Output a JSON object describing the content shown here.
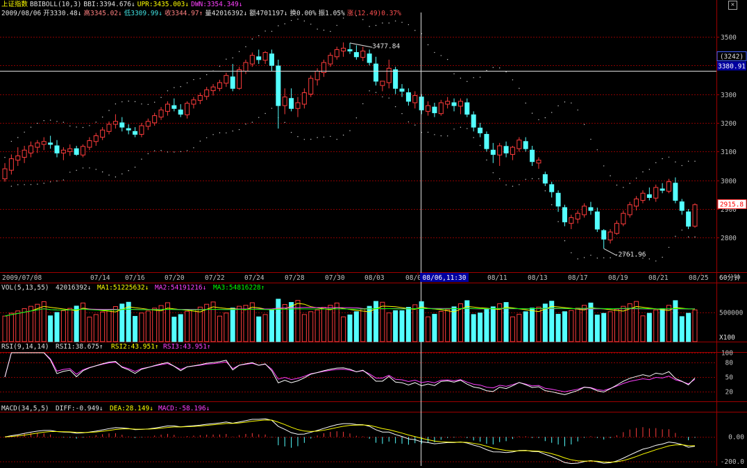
{
  "header": {
    "index_name": "上证指数",
    "indicator": "BBIBOLL(10,3)",
    "bbi": "BBI:3394.676↓",
    "upr": "UPR:3435.003↓",
    "dwn": "DWN:3354.349↓",
    "date": "2009/08/06",
    "open": "开3330.48↓",
    "high": "高3345.02↓",
    "low": "低3309.99↓",
    "close": "收3344.97↑",
    "volume": "量42016392↓",
    "amount": "额4701197↓",
    "turnover": "换0.00%",
    "amplitude": "振1.05%",
    "change": "涨(12.49)0.37%"
  },
  "colors": {
    "up": "#ff3c3c",
    "down": "#54ffff",
    "background": "#000000",
    "grid": "#8b0000",
    "ma1": "#ffff00",
    "ma2": "#ff40ff",
    "ma3": "#00ff00",
    "rsi1": "#ffffff",
    "rsi2": "#ffff00",
    "rsi3": "#ff40ff"
  },
  "icons": {
    "close": "close-icon"
  },
  "chart_data": [
    {
      "type": "candlestick",
      "panel": "price",
      "yticks": [
        2800,
        2900,
        3000,
        3100,
        3200,
        3300,
        3400,
        3500
      ],
      "ylim": [
        2680,
        3560
      ],
      "crosshair_value": "3380.91",
      "crosshair_count": "(3242)",
      "last_price_tag": "2915.8",
      "annotation_high": "3477.84",
      "annotation_low": "2761.96",
      "candles": [
        [
          3005,
          3060,
          2995,
          3040
        ],
        [
          3035,
          3090,
          3020,
          3075
        ],
        [
          3070,
          3115,
          3050,
          3085
        ],
        [
          3080,
          3120,
          3060,
          3105
        ],
        [
          3095,
          3135,
          3080,
          3120
        ],
        [
          3115,
          3140,
          3095,
          3130
        ],
        [
          3125,
          3150,
          3105,
          3135
        ],
        [
          3130,
          3155,
          3110,
          3125
        ],
        [
          3120,
          3140,
          3080,
          3095
        ],
        [
          3095,
          3115,
          3070,
          3105
        ],
        [
          3100,
          3125,
          3085,
          3110
        ],
        [
          3110,
          3120,
          3085,
          3090
        ],
        [
          3088,
          3125,
          3080,
          3118
        ],
        [
          3115,
          3150,
          3105,
          3138
        ],
        [
          3135,
          3165,
          3120,
          3155
        ],
        [
          3150,
          3185,
          3140,
          3175
        ],
        [
          3170,
          3205,
          3160,
          3195
        ],
        [
          3195,
          3230,
          3180,
          3205
        ],
        [
          3200,
          3220,
          3170,
          3185
        ],
        [
          3180,
          3195,
          3160,
          3175
        ],
        [
          3170,
          3185,
          3150,
          3160
        ],
        [
          3160,
          3200,
          3150,
          3190
        ],
        [
          3188,
          3215,
          3175,
          3205
        ],
        [
          3200,
          3235,
          3190,
          3225
        ],
        [
          3220,
          3255,
          3210,
          3245
        ],
        [
          3240,
          3275,
          3225,
          3265
        ],
        [
          3260,
          3285,
          3240,
          3250
        ],
        [
          3245,
          3265,
          3220,
          3230
        ],
        [
          3228,
          3275,
          3215,
          3268
        ],
        [
          3265,
          3290,
          3250,
          3280
        ],
        [
          3278,
          3305,
          3265,
          3295
        ],
        [
          3292,
          3325,
          3280,
          3315
        ],
        [
          3312,
          3335,
          3295,
          3325
        ],
        [
          3320,
          3350,
          3310,
          3340
        ],
        [
          3338,
          3375,
          3325,
          3365
        ],
        [
          3360,
          3405,
          3310,
          3320
        ],
        [
          3320,
          3395,
          3315,
          3385
        ],
        [
          3380,
          3420,
          3370,
          3410
        ],
        [
          3405,
          3445,
          3395,
          3435
        ],
        [
          3430,
          3455,
          3405,
          3420
        ],
        [
          3418,
          3450,
          3405,
          3445
        ],
        [
          3440,
          3455,
          3380,
          3400
        ],
        [
          3398,
          3420,
          3180,
          3260
        ],
        [
          3260,
          3320,
          3230,
          3290
        ],
        [
          3285,
          3320,
          3240,
          3250
        ],
        [
          3250,
          3290,
          3220,
          3270
        ],
        [
          3265,
          3320,
          3250,
          3305
        ],
        [
          3300,
          3365,
          3290,
          3355
        ],
        [
          3350,
          3390,
          3330,
          3380
        ],
        [
          3375,
          3420,
          3360,
          3410
        ],
        [
          3405,
          3445,
          3395,
          3435
        ],
        [
          3430,
          3465,
          3420,
          3455
        ],
        [
          3450,
          3480,
          3430,
          3460
        ],
        [
          3455,
          3478,
          3440,
          3450
        ],
        [
          3445,
          3470,
          3420,
          3430
        ],
        [
          3428,
          3465,
          3415,
          3450
        ],
        [
          3440,
          3455,
          3400,
          3410
        ],
        [
          3405,
          3430,
          3330,
          3345
        ],
        [
          3330,
          3345,
          3310,
          3345
        ],
        [
          3340,
          3420,
          3320,
          3390
        ],
        [
          3385,
          3395,
          3300,
          3320
        ],
        [
          3318,
          3335,
          3290,
          3310
        ],
        [
          3305,
          3320,
          3260,
          3275
        ],
        [
          3270,
          3310,
          3250,
          3295
        ],
        [
          3290,
          3300,
          3230,
          3245
        ],
        [
          3240,
          3275,
          3225,
          3260
        ],
        [
          3255,
          3270,
          3220,
          3235
        ],
        [
          3232,
          3280,
          3225,
          3270
        ],
        [
          3265,
          3290,
          3250,
          3275
        ],
        [
          3270,
          3285,
          3240,
          3260
        ],
        [
          3258,
          3285,
          3230,
          3275
        ],
        [
          3270,
          3285,
          3220,
          3230
        ],
        [
          3228,
          3240,
          3170,
          3185
        ],
        [
          3182,
          3200,
          3150,
          3165
        ],
        [
          3160,
          3170,
          3100,
          3110
        ],
        [
          3105,
          3130,
          3060,
          3090
        ],
        [
          3088,
          3130,
          3050,
          3120
        ],
        [
          3118,
          3135,
          3080,
          3095
        ],
        [
          3090,
          3120,
          3070,
          3115
        ],
        [
          3110,
          3150,
          3100,
          3140
        ],
        [
          3135,
          3150,
          3100,
          3110
        ],
        [
          3105,
          3120,
          3050,
          3065
        ],
        [
          3060,
          3080,
          3040,
          3070
        ],
        [
          3020,
          3030,
          2980,
          2990
        ],
        [
          2985,
          2995,
          2940,
          2960
        ],
        [
          2955,
          2965,
          2890,
          2910
        ],
        [
          2905,
          2915,
          2840,
          2855
        ],
        [
          2850,
          2880,
          2830,
          2870
        ],
        [
          2865,
          2895,
          2850,
          2885
        ],
        [
          2880,
          2920,
          2870,
          2910
        ],
        [
          2905,
          2925,
          2880,
          2895
        ],
        [
          2890,
          2905,
          2820,
          2830
        ],
        [
          2825,
          2830,
          2762,
          2795
        ],
        [
          2792,
          2830,
          2780,
          2820
        ],
        [
          2815,
          2860,
          2810,
          2850
        ],
        [
          2848,
          2895,
          2840,
          2885
        ],
        [
          2880,
          2925,
          2870,
          2915
        ],
        [
          2910,
          2945,
          2895,
          2935
        ],
        [
          2930,
          2965,
          2920,
          2955
        ],
        [
          2950,
          2975,
          2930,
          2940
        ],
        [
          2938,
          2985,
          2925,
          2975
        ],
        [
          2970,
          2990,
          2955,
          2965
        ],
        [
          2962,
          3005,
          2955,
          2995
        ],
        [
          2990,
          3010,
          2920,
          2930
        ],
        [
          2925,
          2935,
          2880,
          2895
        ],
        [
          2890,
          2900,
          2830,
          2840
        ],
        [
          2840,
          2920,
          2835,
          2915
        ]
      ],
      "xticks": [
        "2009/07/08",
        "07/14",
        "07/16",
        "07/20",
        "07/22",
        "07/24",
        "07/28",
        "07/30",
        "08/03",
        "08/05",
        "08/11",
        "08/13",
        "08/17",
        "08/19",
        "08/21",
        "08/25"
      ],
      "cursor_label": "08/06,11:30",
      "period_label": "60分钟"
    },
    {
      "type": "bar",
      "panel": "volume",
      "title": "VOL(5,13,55)",
      "vol_value": "42016392↓",
      "ma1": "MA1:51225632↓",
      "ma2": "MA2:54191216↓",
      "ma3": "MA3:54816228↑",
      "yticks": [
        500000
      ],
      "unit_label": "X100",
      "ylim": [
        0,
        1000000
      ]
    },
    {
      "type": "line",
      "panel": "rsi",
      "title": "RSI(9,14,14)",
      "rsi1": "RSI1:38.675↑",
      "rsi2": "RSI2:43.951↑",
      "rsi3": "RSI3:43.951↑",
      "yticks": [
        100,
        80,
        50,
        20,
        0
      ],
      "ylim": [
        0,
        100
      ]
    },
    {
      "type": "line",
      "panel": "macd",
      "title": "MACD(34,5,5)",
      "diff": "DIFF:-0.949↓",
      "dea": "DEA:28.149↓",
      "macd": "MACD:-58.196↓",
      "yticks": [
        "0.00",
        "-200.0"
      ],
      "ylim": [
        -220,
        200
      ]
    }
  ]
}
